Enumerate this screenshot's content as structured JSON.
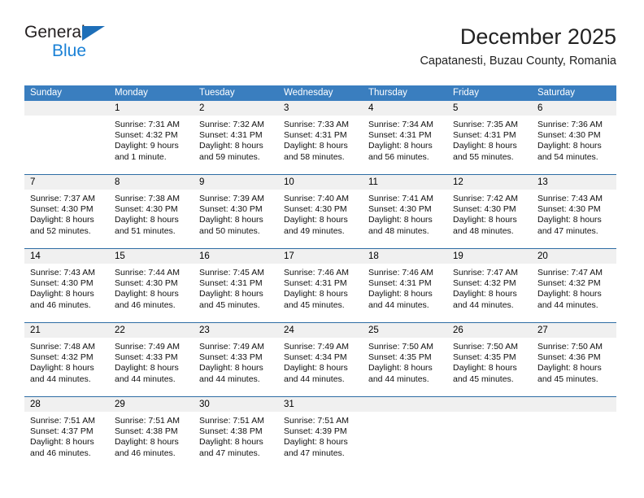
{
  "brand": {
    "word_top": "General",
    "word_bottom": "Blue",
    "triangle_color": "#1e6fb8",
    "blue_color": "#1a81d6"
  },
  "header": {
    "title": "December 2025",
    "subtitle": "Capatanesti, Buzau County, Romania"
  },
  "theme": {
    "header_bar": "#3a7ebf",
    "week_rule": "#2e6da4",
    "day_number_band": "#f0f0f0"
  },
  "calendar": {
    "day_names": [
      "Sunday",
      "Monday",
      "Tuesday",
      "Wednesday",
      "Thursday",
      "Friday",
      "Saturday"
    ],
    "weeks": [
      [
        {
          "day": "",
          "lines": []
        },
        {
          "day": "1",
          "lines": [
            "Sunrise: 7:31 AM",
            "Sunset: 4:32 PM",
            "Daylight: 9 hours",
            "and 1 minute."
          ]
        },
        {
          "day": "2",
          "lines": [
            "Sunrise: 7:32 AM",
            "Sunset: 4:31 PM",
            "Daylight: 8 hours",
            "and 59 minutes."
          ]
        },
        {
          "day": "3",
          "lines": [
            "Sunrise: 7:33 AM",
            "Sunset: 4:31 PM",
            "Daylight: 8 hours",
            "and 58 minutes."
          ]
        },
        {
          "day": "4",
          "lines": [
            "Sunrise: 7:34 AM",
            "Sunset: 4:31 PM",
            "Daylight: 8 hours",
            "and 56 minutes."
          ]
        },
        {
          "day": "5",
          "lines": [
            "Sunrise: 7:35 AM",
            "Sunset: 4:31 PM",
            "Daylight: 8 hours",
            "and 55 minutes."
          ]
        },
        {
          "day": "6",
          "lines": [
            "Sunrise: 7:36 AM",
            "Sunset: 4:30 PM",
            "Daylight: 8 hours",
            "and 54 minutes."
          ]
        }
      ],
      [
        {
          "day": "7",
          "lines": [
            "Sunrise: 7:37 AM",
            "Sunset: 4:30 PM",
            "Daylight: 8 hours",
            "and 52 minutes."
          ]
        },
        {
          "day": "8",
          "lines": [
            "Sunrise: 7:38 AM",
            "Sunset: 4:30 PM",
            "Daylight: 8 hours",
            "and 51 minutes."
          ]
        },
        {
          "day": "9",
          "lines": [
            "Sunrise: 7:39 AM",
            "Sunset: 4:30 PM",
            "Daylight: 8 hours",
            "and 50 minutes."
          ]
        },
        {
          "day": "10",
          "lines": [
            "Sunrise: 7:40 AM",
            "Sunset: 4:30 PM",
            "Daylight: 8 hours",
            "and 49 minutes."
          ]
        },
        {
          "day": "11",
          "lines": [
            "Sunrise: 7:41 AM",
            "Sunset: 4:30 PM",
            "Daylight: 8 hours",
            "and 48 minutes."
          ]
        },
        {
          "day": "12",
          "lines": [
            "Sunrise: 7:42 AM",
            "Sunset: 4:30 PM",
            "Daylight: 8 hours",
            "and 48 minutes."
          ]
        },
        {
          "day": "13",
          "lines": [
            "Sunrise: 7:43 AM",
            "Sunset: 4:30 PM",
            "Daylight: 8 hours",
            "and 47 minutes."
          ]
        }
      ],
      [
        {
          "day": "14",
          "lines": [
            "Sunrise: 7:43 AM",
            "Sunset: 4:30 PM",
            "Daylight: 8 hours",
            "and 46 minutes."
          ]
        },
        {
          "day": "15",
          "lines": [
            "Sunrise: 7:44 AM",
            "Sunset: 4:30 PM",
            "Daylight: 8 hours",
            "and 46 minutes."
          ]
        },
        {
          "day": "16",
          "lines": [
            "Sunrise: 7:45 AM",
            "Sunset: 4:31 PM",
            "Daylight: 8 hours",
            "and 45 minutes."
          ]
        },
        {
          "day": "17",
          "lines": [
            "Sunrise: 7:46 AM",
            "Sunset: 4:31 PM",
            "Daylight: 8 hours",
            "and 45 minutes."
          ]
        },
        {
          "day": "18",
          "lines": [
            "Sunrise: 7:46 AM",
            "Sunset: 4:31 PM",
            "Daylight: 8 hours",
            "and 44 minutes."
          ]
        },
        {
          "day": "19",
          "lines": [
            "Sunrise: 7:47 AM",
            "Sunset: 4:32 PM",
            "Daylight: 8 hours",
            "and 44 minutes."
          ]
        },
        {
          "day": "20",
          "lines": [
            "Sunrise: 7:47 AM",
            "Sunset: 4:32 PM",
            "Daylight: 8 hours",
            "and 44 minutes."
          ]
        }
      ],
      [
        {
          "day": "21",
          "lines": [
            "Sunrise: 7:48 AM",
            "Sunset: 4:32 PM",
            "Daylight: 8 hours",
            "and 44 minutes."
          ]
        },
        {
          "day": "22",
          "lines": [
            "Sunrise: 7:49 AM",
            "Sunset: 4:33 PM",
            "Daylight: 8 hours",
            "and 44 minutes."
          ]
        },
        {
          "day": "23",
          "lines": [
            "Sunrise: 7:49 AM",
            "Sunset: 4:33 PM",
            "Daylight: 8 hours",
            "and 44 minutes."
          ]
        },
        {
          "day": "24",
          "lines": [
            "Sunrise: 7:49 AM",
            "Sunset: 4:34 PM",
            "Daylight: 8 hours",
            "and 44 minutes."
          ]
        },
        {
          "day": "25",
          "lines": [
            "Sunrise: 7:50 AM",
            "Sunset: 4:35 PM",
            "Daylight: 8 hours",
            "and 44 minutes."
          ]
        },
        {
          "day": "26",
          "lines": [
            "Sunrise: 7:50 AM",
            "Sunset: 4:35 PM",
            "Daylight: 8 hours",
            "and 45 minutes."
          ]
        },
        {
          "day": "27",
          "lines": [
            "Sunrise: 7:50 AM",
            "Sunset: 4:36 PM",
            "Daylight: 8 hours",
            "and 45 minutes."
          ]
        }
      ],
      [
        {
          "day": "28",
          "lines": [
            "Sunrise: 7:51 AM",
            "Sunset: 4:37 PM",
            "Daylight: 8 hours",
            "and 46 minutes."
          ]
        },
        {
          "day": "29",
          "lines": [
            "Sunrise: 7:51 AM",
            "Sunset: 4:38 PM",
            "Daylight: 8 hours",
            "and 46 minutes."
          ]
        },
        {
          "day": "30",
          "lines": [
            "Sunrise: 7:51 AM",
            "Sunset: 4:38 PM",
            "Daylight: 8 hours",
            "and 47 minutes."
          ]
        },
        {
          "day": "31",
          "lines": [
            "Sunrise: 7:51 AM",
            "Sunset: 4:39 PM",
            "Daylight: 8 hours",
            "and 47 minutes."
          ]
        },
        {
          "day": "",
          "lines": []
        },
        {
          "day": "",
          "lines": []
        },
        {
          "day": "",
          "lines": []
        }
      ]
    ]
  }
}
